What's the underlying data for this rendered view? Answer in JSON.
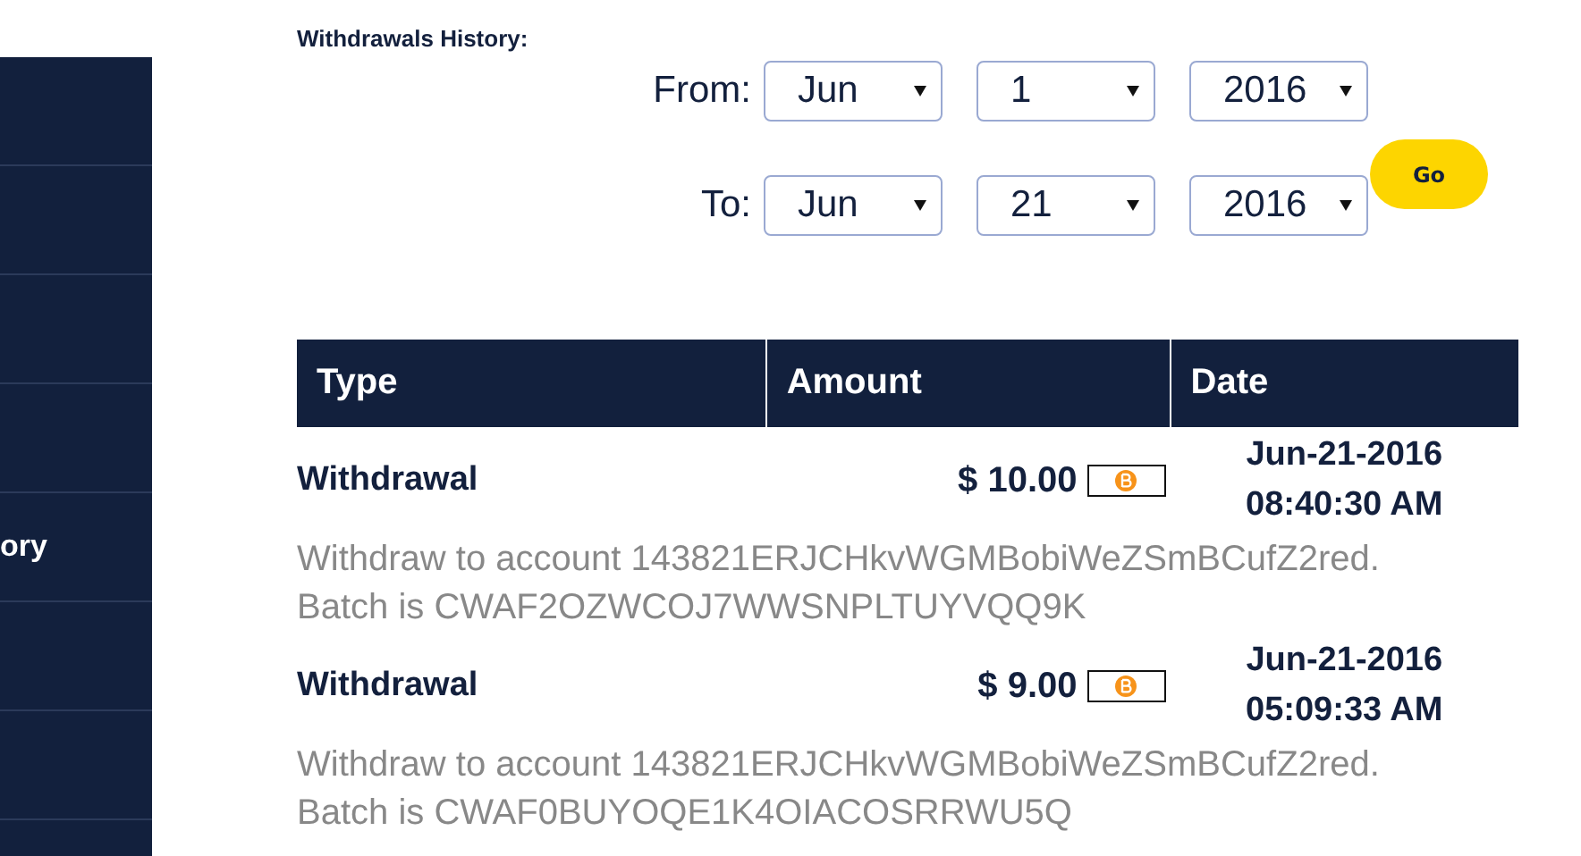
{
  "sidebar": {
    "items": [
      {
        "label": "ory"
      }
    ]
  },
  "filter": {
    "title": "Withdrawals History:",
    "ranges": [
      {
        "label": "From:",
        "month": "Jun",
        "day": "1",
        "year": "2016"
      },
      {
        "label": "To:",
        "month": "Jun",
        "day": "21",
        "year": "2016"
      }
    ],
    "go_button": "Go"
  },
  "table": {
    "columns": [
      "Type",
      "Amount",
      "Date"
    ],
    "rows": [
      {
        "type": "Withdrawal",
        "amount": "$ 10.00",
        "date": "Jun-21-2016",
        "time": "08:40:30 AM",
        "description": "Withdraw to account 143821ERJCHkvWGMBobiWeZSmBCufZ2red.",
        "batch": "Batch is CWAF2OZWCOJ7WWSNPLTUYVQQ9K"
      },
      {
        "type": "Withdrawal",
        "amount": "$ 9.00",
        "date": "Jun-21-2016",
        "time": "05:09:33 AM",
        "description": "Withdraw to account 143821ERJCHkvWGMBobiWeZSmBCufZ2red.",
        "batch": "Batch is CWAF0BUYOQE1K4OIACOSRRWU5Q"
      }
    ]
  }
}
